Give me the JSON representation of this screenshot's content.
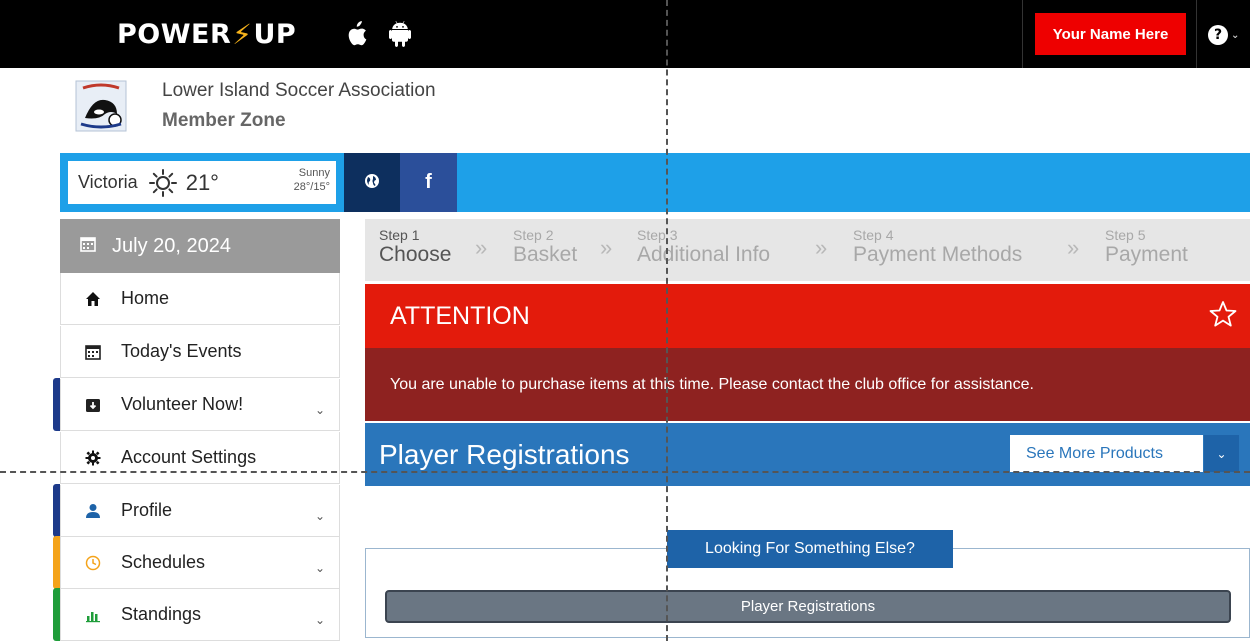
{
  "topbar": {
    "logo_text_left": "POWER",
    "logo_bolt": "⚡",
    "logo_text_right": "UP",
    "icons": [
      "apple-icon",
      "android-icon"
    ],
    "user_button": "Your Name Here",
    "help_icon": "?",
    "help_caret": "⌄"
  },
  "org": {
    "name": "Lower Island Soccer Association",
    "zone": "Member Zone",
    "logo_icon": "orca-crest-logo"
  },
  "weather": {
    "city": "Victoria",
    "temp": "21°",
    "condition": "Sunny",
    "range": "28°/15°",
    "icon": "sun-icon"
  },
  "social": {
    "globe_icon": "globe-icon",
    "facebook_label": "f"
  },
  "sidebar": {
    "date": "July 20, 2024",
    "items": [
      {
        "label": "Home",
        "icon": "home-icon",
        "chevron": false,
        "accent": ""
      },
      {
        "label": "Today's Events",
        "icon": "calendar-icon",
        "chevron": false,
        "accent": ""
      },
      {
        "label": "Volunteer Now!",
        "icon": "volunteer-icon",
        "chevron": true,
        "accent": "#1d3a8a"
      },
      {
        "label": "Account Settings",
        "icon": "gear-icon",
        "chevron": false,
        "accent": ""
      },
      {
        "label": "Profile",
        "icon": "user-icon",
        "chevron": true,
        "accent": "#1d3a8a"
      },
      {
        "label": "Schedules",
        "icon": "clock-icon",
        "chevron": true,
        "accent": "#f4a31a"
      },
      {
        "label": "Standings",
        "icon": "bar-chart-icon",
        "chevron": true,
        "accent": "#1f9d3a"
      }
    ],
    "chevron": "⌄"
  },
  "steps": [
    {
      "num": "Step 1",
      "label": "Choose",
      "active": true
    },
    {
      "num": "Step 2",
      "label": "Basket",
      "active": false
    },
    {
      "num": "Step 3",
      "label": "Additional Info",
      "active": false
    },
    {
      "num": "Step 4",
      "label": "Payment Methods",
      "active": false
    },
    {
      "num": "Step 5",
      "label": "Payment",
      "active": false
    }
  ],
  "step_separator": "»",
  "attention": {
    "title": "ATTENTION",
    "message": "You are unable to purchase items at this time. Please contact the club office for assistance.",
    "star_icon": "star-icon"
  },
  "registrations": {
    "title": "Player Registrations",
    "more_button": "See More Products",
    "dropdown_caret": "⌄"
  },
  "look": {
    "heading": "Looking For Something Else?",
    "button": "Player Registrations"
  },
  "colors": {
    "topbar": "#000000",
    "brand_bolt": "#f6b21b",
    "user_button": "#ee0000",
    "strip": "#1ea0e8",
    "attention": "#e31b0c",
    "attention_body": "#8e2220",
    "registrations": "#2a76bb"
  }
}
